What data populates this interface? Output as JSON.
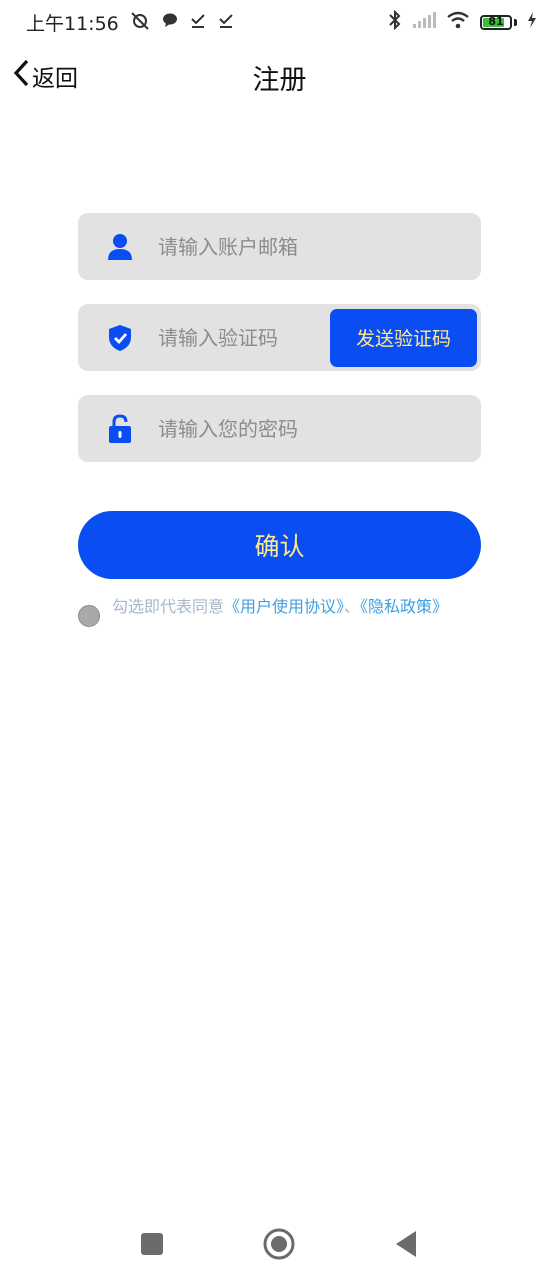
{
  "status_bar": {
    "time": "上午11:56",
    "battery_level": "81"
  },
  "nav": {
    "back_label": "返回",
    "title": "注册"
  },
  "form": {
    "email_placeholder": "请输入账户邮箱",
    "code_placeholder": "请输入验证码",
    "send_code_label": "发送验证码",
    "password_placeholder": "请输入您的密码",
    "confirm_label": "确认"
  },
  "agreement": {
    "prefix": "勾选即代表同意",
    "user_agreement": "《用户使用协议》",
    "separator": "、",
    "privacy_policy": "《隐私政策》"
  },
  "colors": {
    "primary": "#0a4df2",
    "button_text": "#ffe98a",
    "field_bg": "#e2e2e2",
    "link": "#3fa0de"
  },
  "icons": {
    "email": "user-icon",
    "code": "shield-check-icon",
    "password": "lock-icon"
  }
}
